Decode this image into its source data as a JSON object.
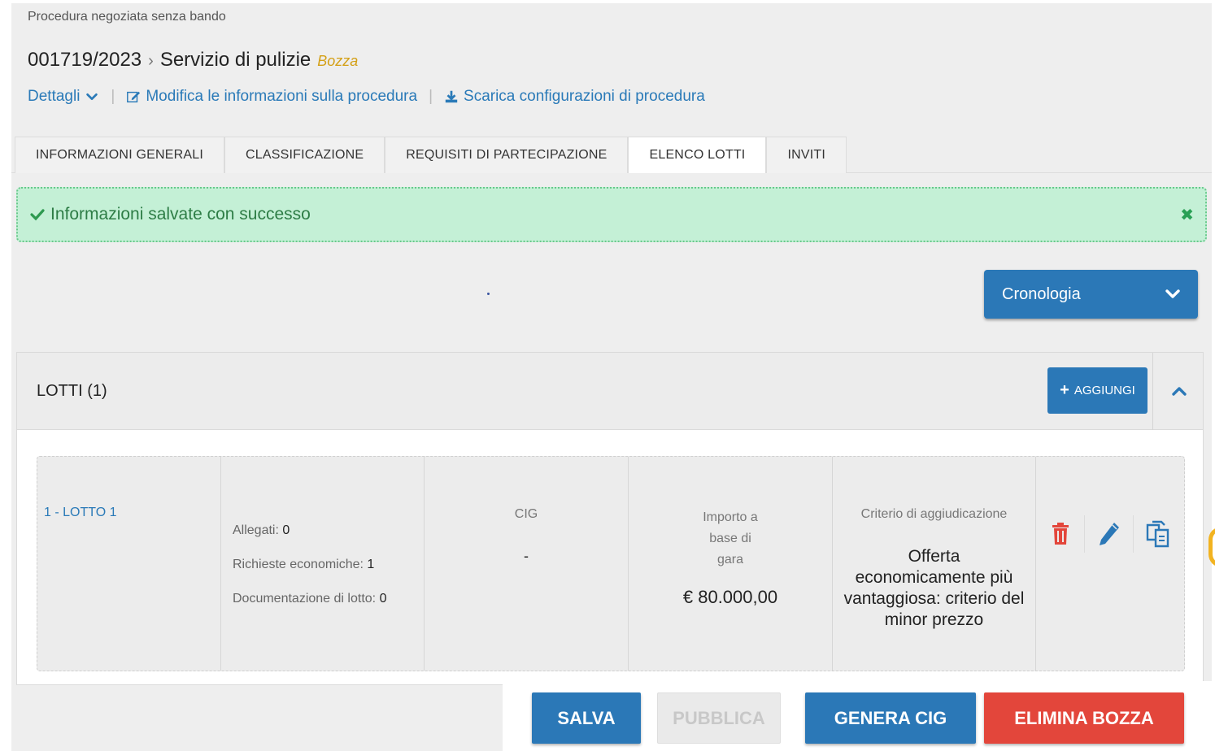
{
  "header": {
    "subtitle": "Procedura negoziata senza bando",
    "code": "001719/2023",
    "breadcrumb_sep": "›",
    "title": "Servizio di pulizie",
    "status": "Bozza",
    "links": {
      "details": "Dettagli",
      "edit": "Modifica le informazioni sulla procedura",
      "download": "Scarica configurazioni di procedura",
      "separator": "|"
    }
  },
  "tabs": [
    {
      "label": "INFORMAZIONI GENERALI",
      "active": false
    },
    {
      "label": "CLASSIFICAZIONE",
      "active": false
    },
    {
      "label": "REQUISITI DI PARTECIPAZIONE",
      "active": false
    },
    {
      "label": "ELENCO LOTTI",
      "active": true
    },
    {
      "label": "INVITI",
      "active": false
    }
  ],
  "alert": {
    "message": "Informazioni salvate con successo",
    "close_symbol": "✖"
  },
  "cronologia": {
    "label": "Cronologia"
  },
  "lotti": {
    "title": "LOTTI (1)",
    "add_label": "AGGIUNGI",
    "items": [
      {
        "name": "1 - LOTTO 1",
        "allegati_label": "Allegati:",
        "allegati_value": "0",
        "richieste_label": "Richieste economiche:",
        "richieste_value": "1",
        "documentazione_label": "Documentazione di lotto:",
        "documentazione_value": "0",
        "cig_label": "CIG",
        "cig_value": "-",
        "importo_label_1": "Importo a",
        "importo_label_2": "base di",
        "importo_label_3": "gara",
        "importo_value": "€ 80.000,00",
        "criterio_label": "Criterio di aggiudicazione",
        "criterio_value": "Offerta economicamente più vantaggiosa: criterio del minor prezzo"
      }
    ]
  },
  "footer": {
    "salva": "SALVA",
    "pubblica": "PUBBLICA",
    "genera_cig": "GENERA CIG",
    "elimina_bozza": "ELIMINA BOZZA"
  },
  "colors": {
    "primary": "#2b78b7",
    "danger": "#e3463b",
    "success_bg": "#c4f0d6",
    "success_text": "#2e7d46",
    "draft_badge": "#d4a017",
    "link": "#2a7ab8"
  }
}
